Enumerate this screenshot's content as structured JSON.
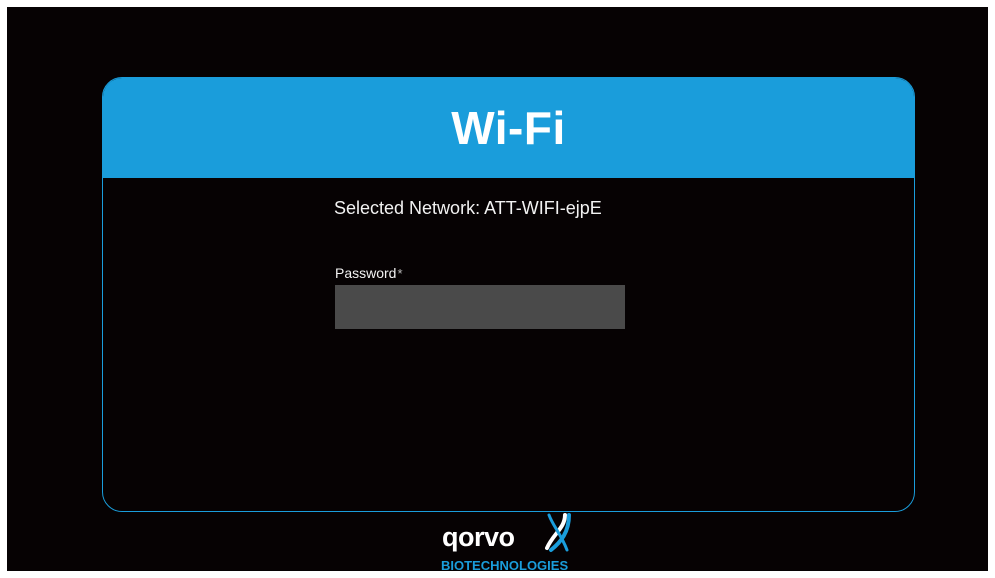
{
  "dialog": {
    "title": "Wi-Fi",
    "network_line": "Selected Network: ATT-WIFI-ejpE",
    "password_label": "Password",
    "required_mark": "*",
    "password_value": ""
  },
  "brand": {
    "logo_text": "qorvo",
    "logo_subtext": "BIOTECHNOLOGIES",
    "colors": {
      "accent": "#1a9ddb",
      "background": "#060203",
      "input_fill": "#4a4a4a",
      "text": "#f2f2f2"
    }
  }
}
